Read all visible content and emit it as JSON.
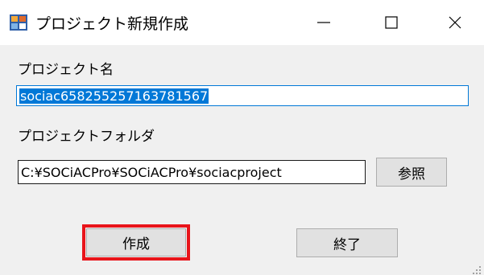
{
  "window": {
    "title": "プロジェクト新規作成",
    "controls": {
      "minimize": "minimize",
      "maximize": "maximize",
      "close": "close"
    }
  },
  "form": {
    "project_name_label": "プロジェクト名",
    "project_name_value": "sociac658255257163781567",
    "project_folder_label": "プロジェクトフォルダ",
    "project_folder_value": "C:¥SOCiACPro¥SOCiACPro¥sociacproject",
    "browse_label": "参照"
  },
  "actions": {
    "create_label": "作成",
    "exit_label": "終了"
  },
  "colors": {
    "highlight": "#e8141a",
    "selection": "#0078d7"
  }
}
